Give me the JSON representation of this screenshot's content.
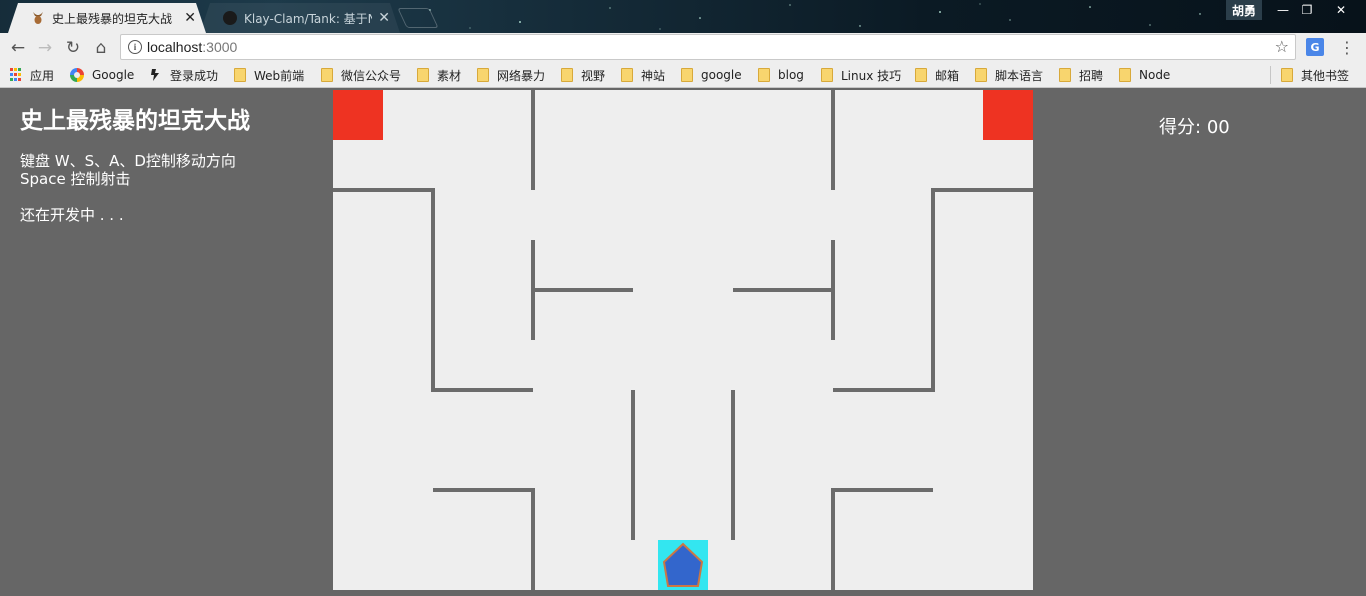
{
  "browser": {
    "tabs": [
      {
        "title": "史上最残暴的坦克大战",
        "active": true
      },
      {
        "title": "Klay-Clam/Tank: 基于N",
        "active": false
      }
    ],
    "user_name": "胡勇",
    "url_host": "localhost",
    "url_port": ":3000",
    "bookmarks": [
      {
        "label": "应用",
        "icon": "apps-icon"
      },
      {
        "label": "Google",
        "icon": "google-icon"
      },
      {
        "label": "登录成功",
        "icon": "page-icon"
      },
      {
        "label": "Web前端",
        "icon": "folder-icon"
      },
      {
        "label": "微信公众号",
        "icon": "folder-icon"
      },
      {
        "label": "素材",
        "icon": "folder-icon"
      },
      {
        "label": "网络暴力",
        "icon": "folder-icon"
      },
      {
        "label": "视野",
        "icon": "folder-icon"
      },
      {
        "label": "神站",
        "icon": "folder-icon"
      },
      {
        "label": "google",
        "icon": "folder-icon"
      },
      {
        "label": "blog",
        "icon": "folder-icon"
      },
      {
        "label": "Linux 技巧",
        "icon": "folder-icon"
      },
      {
        "label": "邮箱",
        "icon": "folder-icon"
      },
      {
        "label": "脚本语言",
        "icon": "folder-icon"
      },
      {
        "label": "招聘",
        "icon": "folder-icon"
      },
      {
        "label": "Node",
        "icon": "folder-icon"
      }
    ],
    "other_bookmarks": "其他书签"
  },
  "page": {
    "title": "史上最残暴的坦克大战",
    "controls_line1": "键盘 W、S、A、D控制移动方向",
    "controls_line2": "Space 控制射击",
    "status": "还在开发中 . . .",
    "score_label": "得分:",
    "score_value": "00"
  },
  "game": {
    "colors": {
      "arena": "#eeeeee",
      "wall": "#6b6b6b",
      "enemy": "#ee3322",
      "player_cell": "#33e6f0",
      "player_body": "#3366cc",
      "player_outline": "#cc7744"
    }
  }
}
